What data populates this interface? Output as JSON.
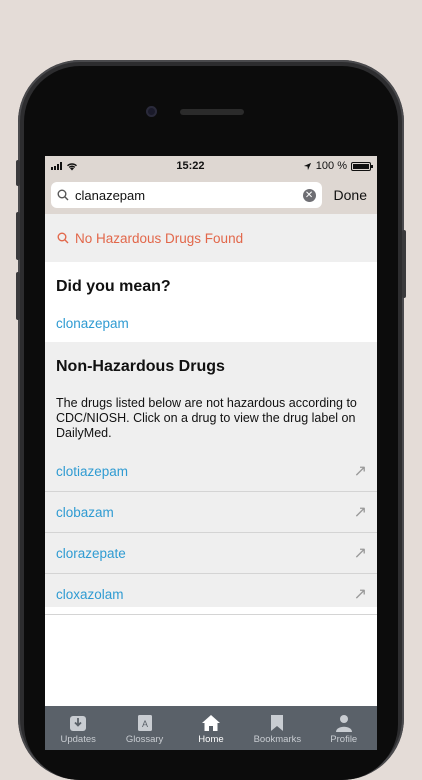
{
  "status_bar": {
    "time": "15:22",
    "battery": "100 %"
  },
  "search": {
    "value": "clanazepam",
    "done_label": "Done"
  },
  "no_results": {
    "text": "No Hazardous Drugs Found"
  },
  "did_you_mean": {
    "title": "Did you mean?",
    "suggestion": "clonazepam"
  },
  "non_hazardous": {
    "title": "Non-Hazardous Drugs",
    "description": "The drugs listed below are not hazardous according to CDC/NIOSH. Click on a drug to view the drug label on DailyMed.",
    "drugs": [
      "clotiazepam",
      "clobazam",
      "clorazepate",
      "cloxazolam"
    ]
  },
  "tabs": [
    {
      "label": "Updates",
      "icon": "download-icon"
    },
    {
      "label": "Glossary",
      "icon": "book-icon"
    },
    {
      "label": "Home",
      "icon": "home-icon"
    },
    {
      "label": "Bookmarks",
      "icon": "bookmark-icon"
    },
    {
      "label": "Profile",
      "icon": "person-icon"
    }
  ],
  "colors": {
    "accent_link": "#2f9bd2",
    "warning": "#e2674a",
    "tabbar": "#5a6169",
    "header_bg": "#ded7d2"
  }
}
